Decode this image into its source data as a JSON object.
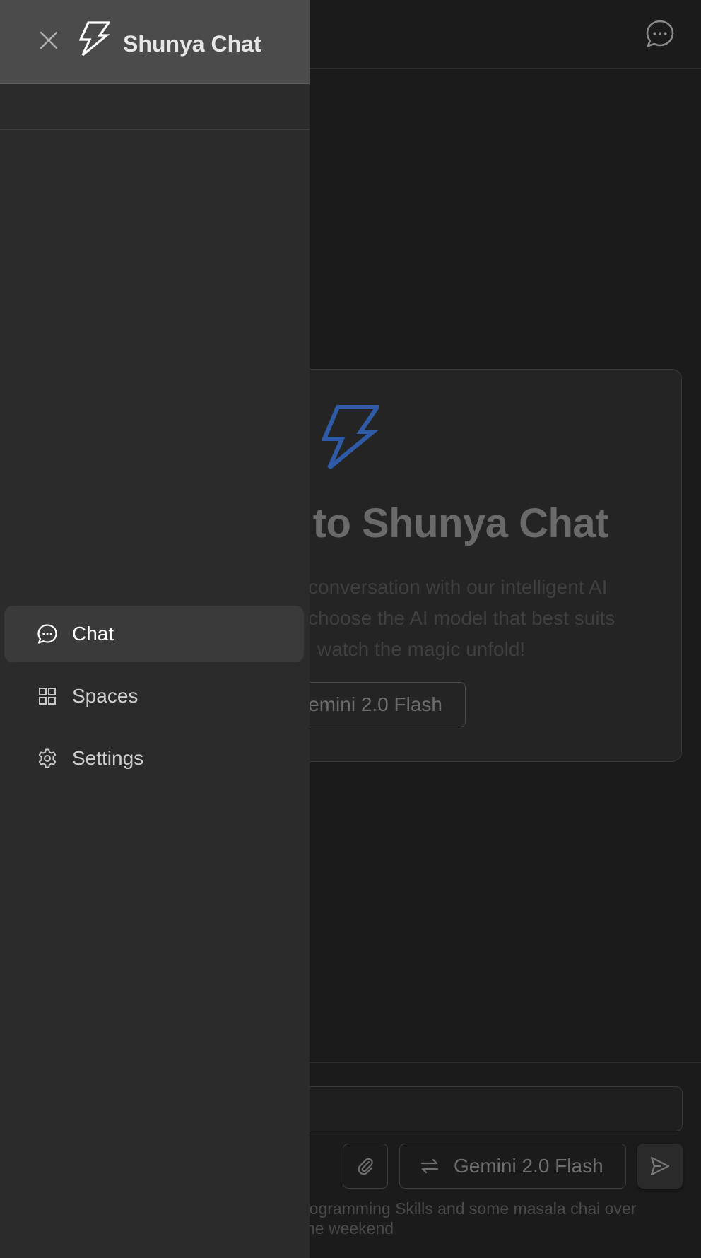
{
  "app": {
    "title": "Shunya Chat"
  },
  "header": {
    "new_chat_icon": "chat-bubble-dots-icon"
  },
  "welcome": {
    "title": "to Shunya Chat",
    "description_lines": [
      "conversation with our intelligent AI",
      "choose the AI model that best suits",
      "watch the magic unfold!"
    ],
    "model_button_label": "emini 2.0 Flash",
    "logo_color": "#2f5aa6"
  },
  "composer": {
    "model_label": "Gemini 2.0 Flash",
    "footer_lines": [
      "rogramming Skills and some masala chai over",
      "he weekend"
    ]
  },
  "sidebar": {
    "title": "Shunya Chat",
    "items": [
      {
        "label": "Chat",
        "icon": "chat-bubble-dots-icon",
        "active": true
      },
      {
        "label": "Spaces",
        "icon": "grid-icon",
        "active": false
      },
      {
        "label": "Settings",
        "icon": "gear-icon",
        "active": false
      }
    ]
  }
}
